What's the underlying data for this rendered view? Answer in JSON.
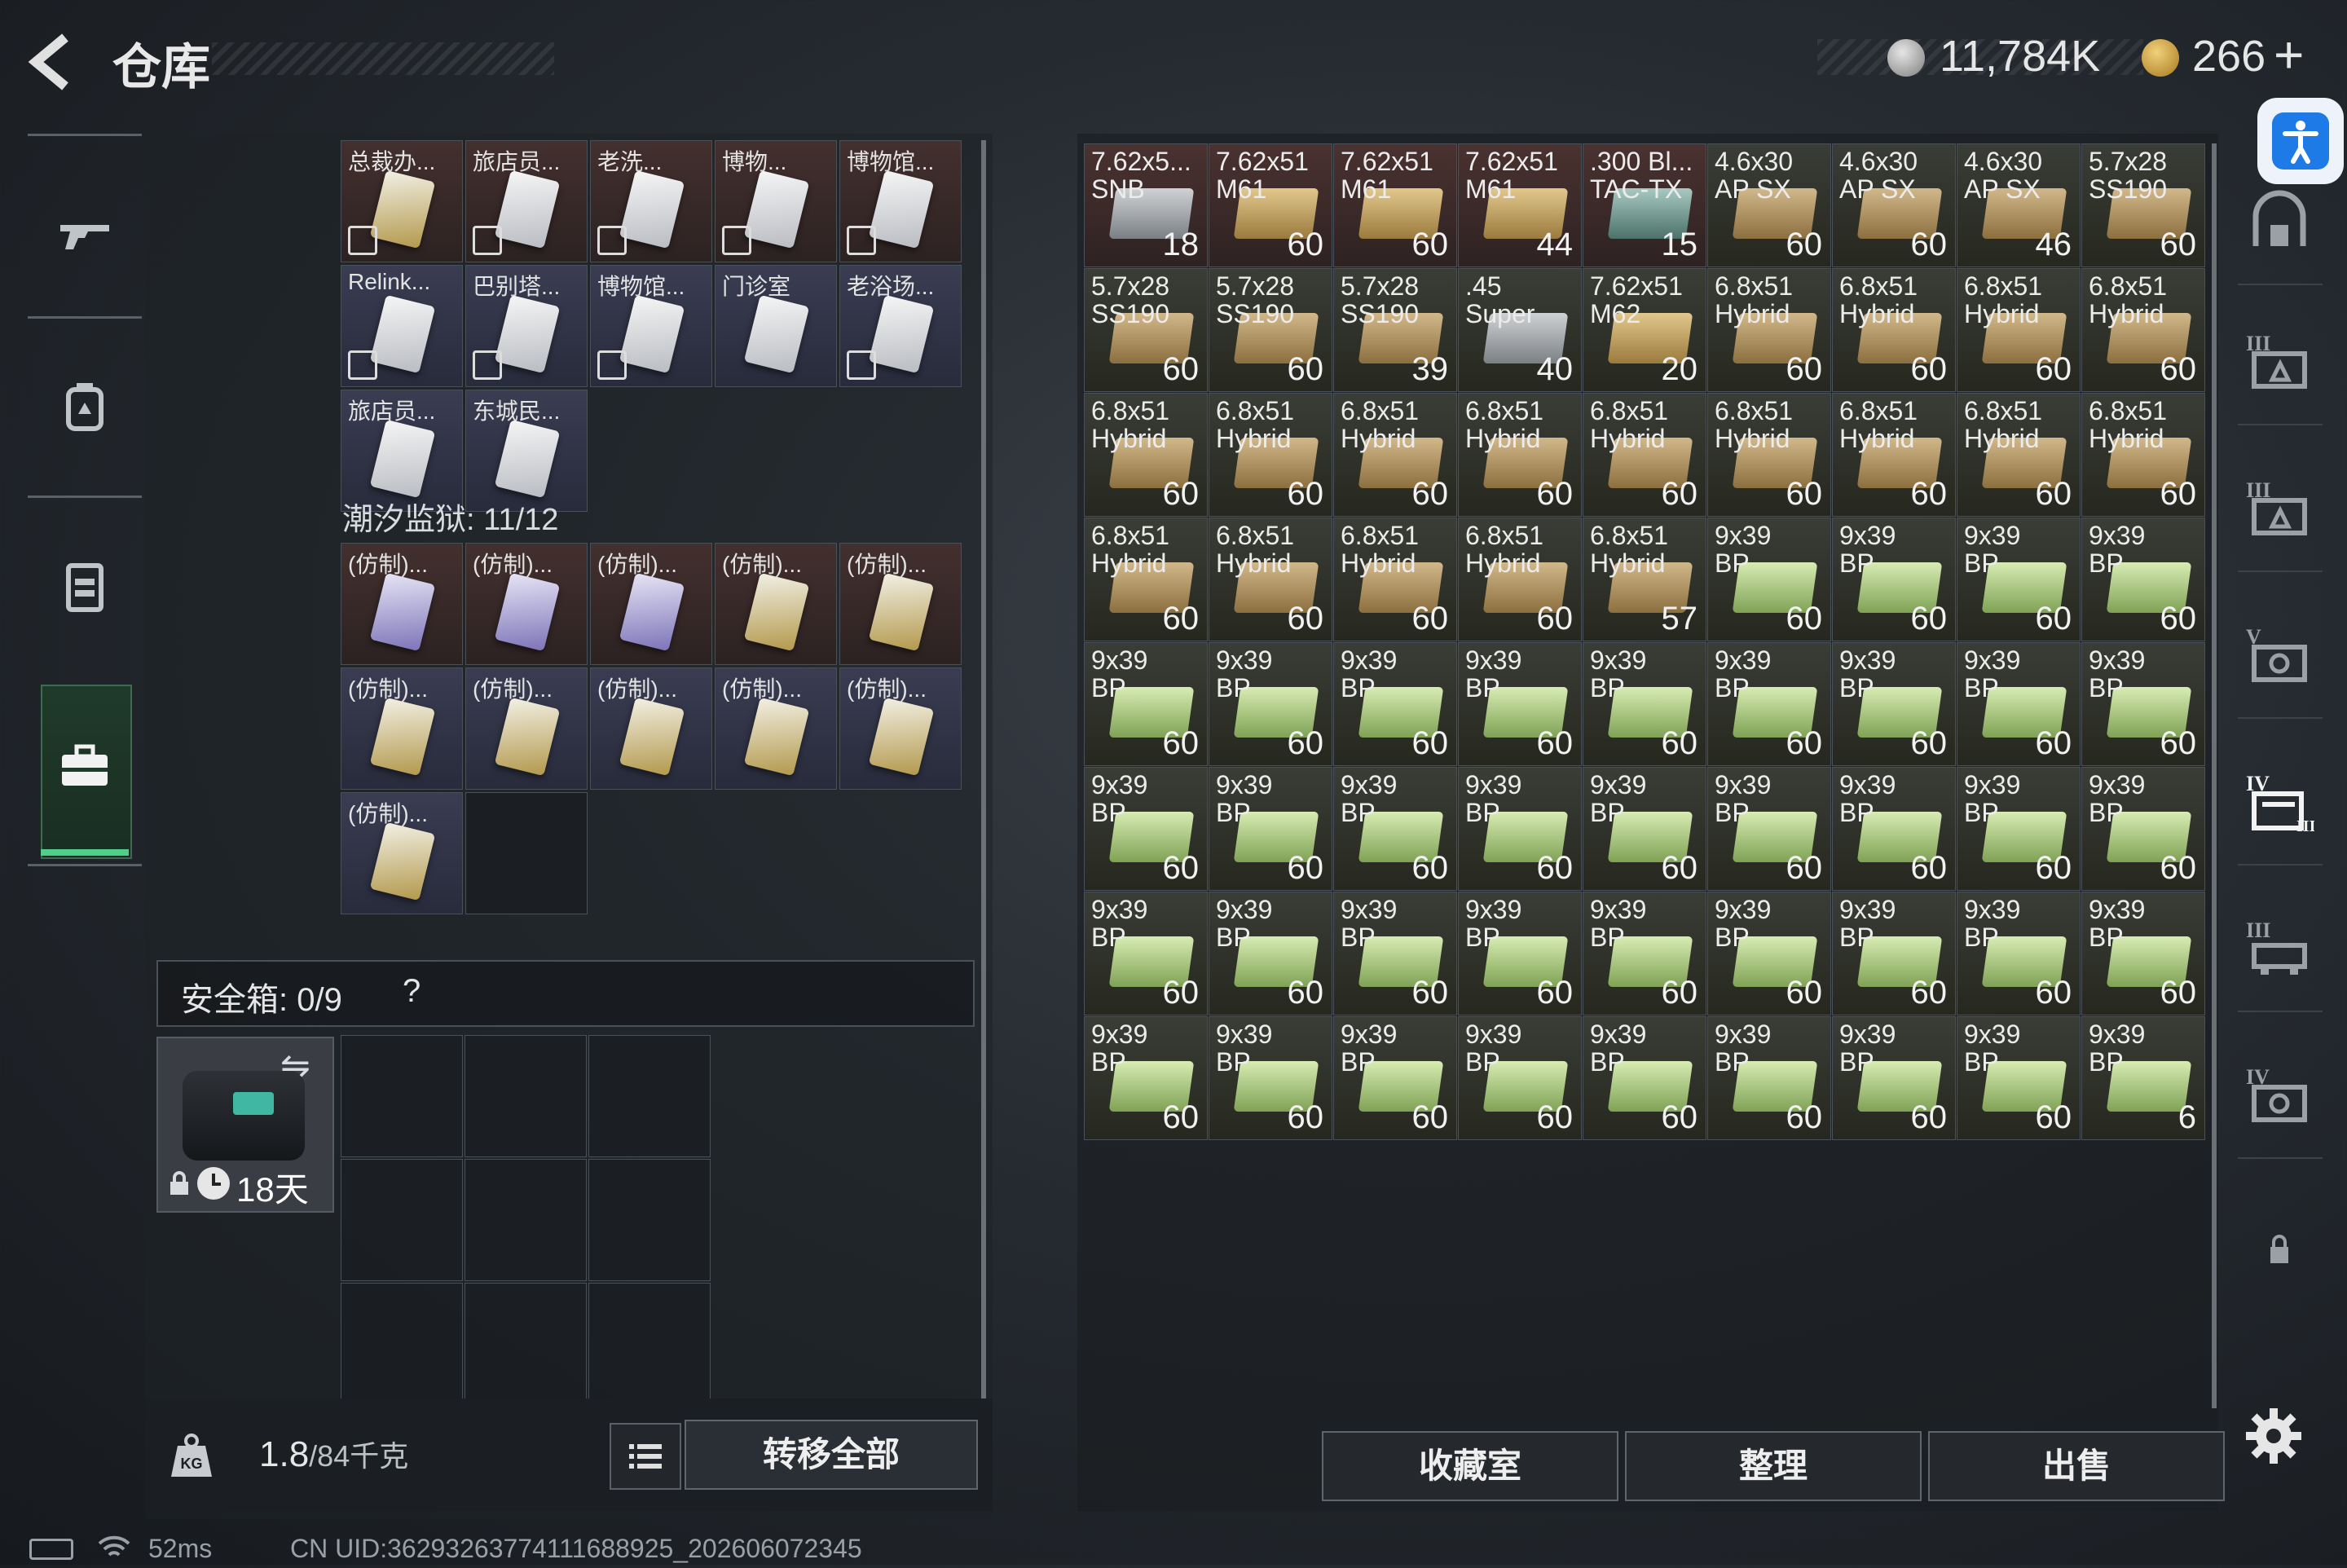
{
  "header": {
    "title": "仓库",
    "currency_silver": "11,784K",
    "currency_gold": "266",
    "plus_label": "+"
  },
  "left_rail": {
    "items": [
      "weapon-icon",
      "backpack-icon",
      "rig-icon",
      "case-icon"
    ],
    "active": "case-icon"
  },
  "keycards": {
    "row1": [
      "总裁办...",
      "旅店员...",
      "老洗...",
      "博物...",
      "博物馆..."
    ],
    "row2": [
      "Relink...",
      "巴别塔...",
      "博物馆...",
      "门诊室",
      "老浴场..."
    ],
    "row3": [
      "旅店员...",
      "东城民..."
    ],
    "section_label": "潮汐监狱: 11/12",
    "replica_label": "(仿制)..."
  },
  "safe": {
    "label": "安全箱: 0/9",
    "help": "?",
    "days": "18天"
  },
  "footer": {
    "weight_value": "1.8",
    "weight_max": "/84千克",
    "transfer_all": "转移全部"
  },
  "ammo_rows": [
    [
      [
        "7.62x5...\nSNB",
        "18",
        "grey",
        "r"
      ],
      [
        "7.62x51\nM61",
        "60",
        "tan",
        "r"
      ],
      [
        "7.62x51\nM61",
        "60",
        "tan",
        "r"
      ],
      [
        "7.62x51\nM61",
        "44",
        "tan",
        "r"
      ],
      [
        ".300 Bl...\nTAC-TX",
        "15",
        "teal",
        "r"
      ],
      [
        "4.6x30\nAP SX",
        "60",
        "brown",
        "g"
      ],
      [
        "4.6x30\nAP SX",
        "60",
        "brown",
        "g"
      ],
      [
        "4.6x30\nAP SX",
        "46",
        "brown",
        "g"
      ],
      [
        "5.7x28\nSS190",
        "60",
        "brown",
        "g"
      ]
    ],
    [
      [
        "5.7x28\nSS190",
        "60",
        "brown",
        "g"
      ],
      [
        "5.7x28\nSS190",
        "60",
        "brown",
        "g"
      ],
      [
        "5.7x28\nSS190",
        "39",
        "brown",
        "g"
      ],
      [
        ".45\nSuper",
        "40",
        "grey",
        "g"
      ],
      [
        "7.62x51\nM62",
        "20",
        "tan",
        "g"
      ],
      [
        "6.8x51\nHybrid",
        "60",
        "brown",
        "g"
      ],
      [
        "6.8x51\nHybrid",
        "60",
        "brown",
        "g"
      ],
      [
        "6.8x51\nHybrid",
        "60",
        "brown",
        "g"
      ],
      [
        "6.8x51\nHybrid",
        "60",
        "brown",
        "g"
      ]
    ],
    [
      [
        "6.8x51\nHybrid",
        "60",
        "brown",
        "g"
      ],
      [
        "6.8x51\nHybrid",
        "60",
        "brown",
        "g"
      ],
      [
        "6.8x51\nHybrid",
        "60",
        "brown",
        "g"
      ],
      [
        "6.8x51\nHybrid",
        "60",
        "brown",
        "g"
      ],
      [
        "6.8x51\nHybrid",
        "60",
        "brown",
        "g"
      ],
      [
        "6.8x51\nHybrid",
        "60",
        "brown",
        "g"
      ],
      [
        "6.8x51\nHybrid",
        "60",
        "brown",
        "g"
      ],
      [
        "6.8x51\nHybrid",
        "60",
        "brown",
        "g"
      ],
      [
        "6.8x51\nHybrid",
        "60",
        "brown",
        "g"
      ]
    ],
    [
      [
        "6.8x51\nHybrid",
        "60",
        "brown",
        "g"
      ],
      [
        "6.8x51\nHybrid",
        "60",
        "brown",
        "g"
      ],
      [
        "6.8x51\nHybrid",
        "60",
        "brown",
        "g"
      ],
      [
        "6.8x51\nHybrid",
        "60",
        "brown",
        "g"
      ],
      [
        "6.8x51\nHybrid",
        "57",
        "brown",
        "g"
      ],
      [
        "9x39\nBP",
        "60",
        "green",
        "g"
      ],
      [
        "9x39\nBP",
        "60",
        "green",
        "g"
      ],
      [
        "9x39\nBP",
        "60",
        "green",
        "g"
      ],
      [
        "9x39\nBP",
        "60",
        "green",
        "g"
      ]
    ],
    [
      [
        "9x39\nBP",
        "60",
        "green",
        "g"
      ],
      [
        "9x39\nBP",
        "60",
        "green",
        "g"
      ],
      [
        "9x39\nBP",
        "60",
        "green",
        "g"
      ],
      [
        "9x39\nBP",
        "60",
        "green",
        "g"
      ],
      [
        "9x39\nBP",
        "60",
        "green",
        "g"
      ],
      [
        "9x39\nBP",
        "60",
        "green",
        "g"
      ],
      [
        "9x39\nBP",
        "60",
        "green",
        "g"
      ],
      [
        "9x39\nBP",
        "60",
        "green",
        "g"
      ],
      [
        "9x39\nBP",
        "60",
        "green",
        "g"
      ]
    ],
    [
      [
        "9x39\nBP",
        "60",
        "green",
        "g"
      ],
      [
        "9x39\nBP",
        "60",
        "green",
        "g"
      ],
      [
        "9x39\nBP",
        "60",
        "green",
        "g"
      ],
      [
        "9x39\nBP",
        "60",
        "green",
        "g"
      ],
      [
        "9x39\nBP",
        "60",
        "green",
        "g"
      ],
      [
        "9x39\nBP",
        "60",
        "green",
        "g"
      ],
      [
        "9x39\nBP",
        "60",
        "green",
        "g"
      ],
      [
        "9x39\nBP",
        "60",
        "green",
        "g"
      ],
      [
        "9x39\nBP",
        "60",
        "green",
        "g"
      ]
    ],
    [
      [
        "9x39\nBP",
        "60",
        "green",
        "g"
      ],
      [
        "9x39\nBP",
        "60",
        "green",
        "g"
      ],
      [
        "9x39\nBP",
        "60",
        "green",
        "g"
      ],
      [
        "9x39\nBP",
        "60",
        "green",
        "g"
      ],
      [
        "9x39\nBP",
        "60",
        "green",
        "g"
      ],
      [
        "9x39\nBP",
        "60",
        "green",
        "g"
      ],
      [
        "9x39\nBP",
        "60",
        "green",
        "g"
      ],
      [
        "9x39\nBP",
        "60",
        "green",
        "g"
      ],
      [
        "9x39\nBP",
        "60",
        "green",
        "g"
      ]
    ],
    [
      [
        "9x39\nBP",
        "60",
        "green",
        "g"
      ],
      [
        "9x39\nBP",
        "60",
        "green",
        "g"
      ],
      [
        "9x39\nBP",
        "60",
        "green",
        "g"
      ],
      [
        "9x39\nBP",
        "60",
        "green",
        "g"
      ],
      [
        "9x39\nBP",
        "60",
        "green",
        "g"
      ],
      [
        "9x39\nBP",
        "60",
        "green",
        "g"
      ],
      [
        "9x39\nBP",
        "60",
        "green",
        "g"
      ],
      [
        "9x39\nBP",
        "60",
        "green",
        "g"
      ],
      [
        "9x39\nBP",
        "6",
        "green",
        "g"
      ]
    ]
  ],
  "bottom_buttons": {
    "collection": "收藏室",
    "sort": "整理",
    "sell": "出售"
  },
  "status": {
    "ping": "52ms",
    "uid": "CN UID:36293263774111688925_202606072345"
  },
  "colors": {
    "accent_green": "#4fd089",
    "accessibility_blue": "#1e7ae6"
  }
}
